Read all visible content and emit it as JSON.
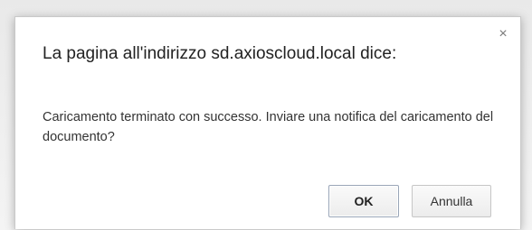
{
  "dialog": {
    "title": "La pagina all'indirizzo sd.axioscloud.local dice:",
    "message": "Caricamento terminato con successo. Inviare una notifica del caricamento del documento?",
    "close_glyph": "×",
    "close_icon": "close-icon",
    "buttons": {
      "ok_label": "OK",
      "cancel_label": "Annulla"
    }
  }
}
